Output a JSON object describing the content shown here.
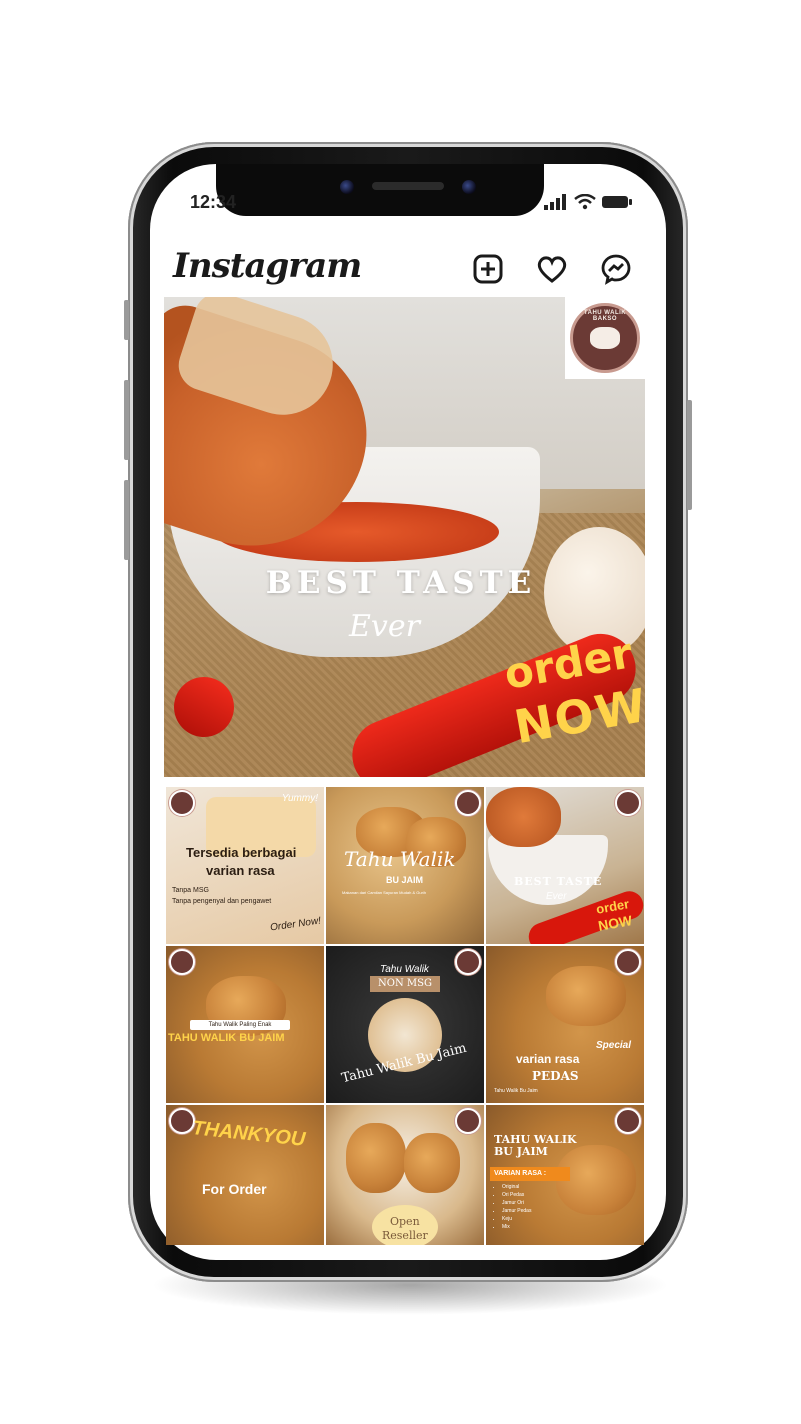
{
  "status_bar": {
    "time": "12:34"
  },
  "app": {
    "title": "Instagram"
  },
  "icons": {
    "new_post": "plus-square-icon",
    "activity": "heart-icon",
    "messenger": "messenger-icon"
  },
  "hero": {
    "title": "BEST TASTE",
    "script": "Ever",
    "order": "order",
    "now": "NOW"
  },
  "logo": {
    "text": "TAHU WALIK BAKSO"
  },
  "posts": [
    {
      "line1": "Tersedia berbagai",
      "line2": "varian rasa",
      "note1": "Tanpa MSG",
      "note2": "Tanpa pengenyal dan pengawet",
      "cta": "Order Now!",
      "tag": "Yummy!"
    },
    {
      "title": "Tahu Walik",
      "subtitle": "BU JAIM",
      "caption": "Makanan dari Camilan Sayuran Mudah & Gurih"
    },
    {
      "title": "BEST TASTE",
      "script": "Ever",
      "order": "order",
      "now": "NOW"
    },
    {
      "label": "Tahu Walik Paling Enak",
      "headline": "TAHU WALIK BU JAIM"
    },
    {
      "top": "Tahu Walik",
      "badge": "NON MSG",
      "arc": "Tahu Walik Bu Jaim"
    },
    {
      "special": "Special",
      "line1": "varian rasa",
      "line2": "PEDAS",
      "foot": "Tahu Walik Bu Jaim"
    },
    {
      "title": "THANKYOU",
      "subtitle": "For Order"
    },
    {
      "line1": "Open",
      "line2": "Reseller"
    },
    {
      "title1": "TAHU WALIK",
      "title2": "BU JAIM",
      "badge": "VARIAN RASA :",
      "items": [
        "Original",
        "Ori Pedas",
        "Jamur Ori",
        "Jamur Pedas",
        "Keju",
        "Mix"
      ]
    }
  ],
  "colors": {
    "accent_yellow": "#ffd34a",
    "logo_brown": "#6b3a35",
    "chili_red": "#d8170c"
  }
}
